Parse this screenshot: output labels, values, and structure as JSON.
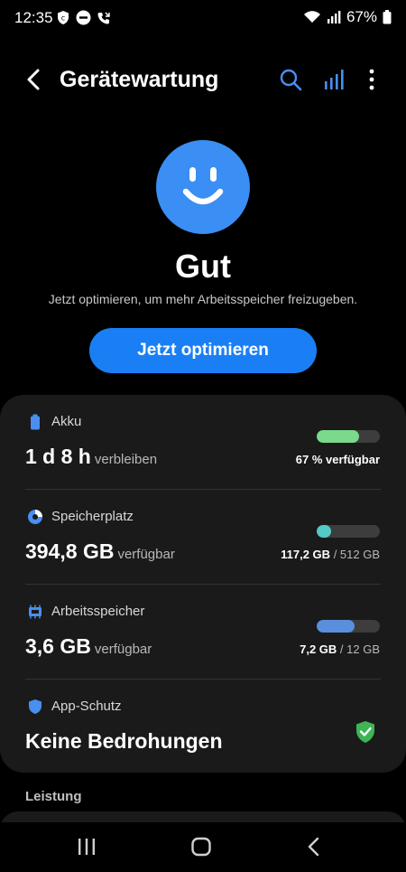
{
  "status_bar": {
    "time": "12:35",
    "battery_percent": "67%",
    "icons": [
      "shield-icon",
      "do-not-disturb-icon",
      "call-icon",
      "wifi-icon",
      "signal-icon",
      "battery-icon"
    ]
  },
  "app_bar": {
    "title": "Gerätewartung",
    "icons": [
      "back-arrow-icon",
      "search-icon",
      "stats-icon",
      "more-vert-icon"
    ]
  },
  "status": {
    "title": "Gut",
    "subtitle": "Jetzt optimieren, um mehr Arbeitsspeicher freizugeben.",
    "button_label": "Jetzt optimieren"
  },
  "sections": {
    "battery": {
      "label": "Akku",
      "value": "1 d 8 h",
      "unit": "verbleiben",
      "right_text": "67 % verfügbar",
      "fill_percent": 67,
      "bar_color": "#7ad98a"
    },
    "storage": {
      "label": "Speicherplatz",
      "value": "394,8 GB",
      "unit": "verfügbar",
      "used": "117,2 GB",
      "total": "/ 512 GB",
      "fill_percent": 23,
      "bar_color": "#55c8c8"
    },
    "memory": {
      "label": "Arbeitsspeicher",
      "value": "3,6 GB",
      "unit": "verfügbar",
      "used": "7,2 GB",
      "total": "/ 12 GB",
      "fill_percent": 60,
      "bar_color": "#5a8fdd"
    },
    "protection": {
      "label": "App-Schutz",
      "value": "Keine Bedrohungen"
    }
  },
  "performance_header": "Leistung",
  "colors": {
    "accent": "#1a7ff5",
    "face": "#3b8ef3",
    "icon_blue": "#4a8ef0",
    "shield_green": "#3fb455"
  }
}
